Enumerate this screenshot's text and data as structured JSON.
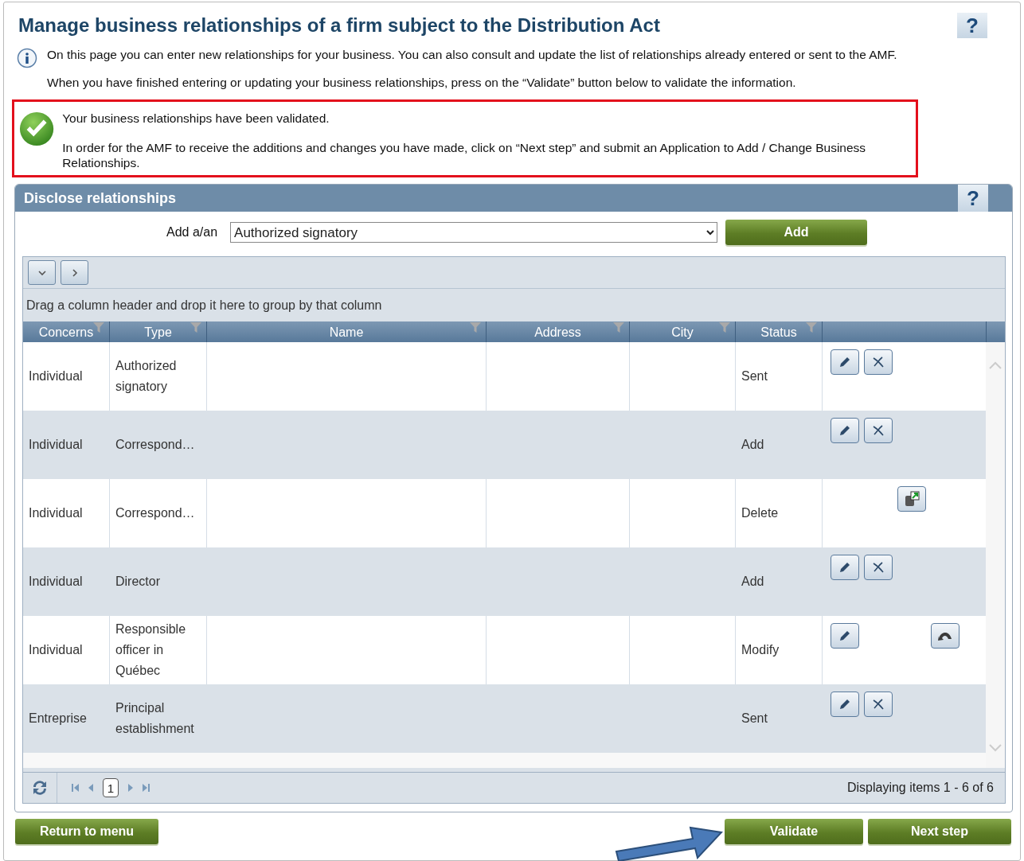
{
  "page": {
    "title": "Manage business relationships of a firm subject to the Distribution Act",
    "help": "?",
    "info": [
      "On this page you can enter new relationships for your business. You can also consult and update the list of relationships already entered or sent to the AMF.",
      "When you have finished entering or updating your business relationships, press on the “Validate” button below to validate the information."
    ]
  },
  "success": {
    "lines": [
      "Your business relationships have been validated.",
      "In order for the AMF to receive the additions and changes you have made, click on “Next step” and submit an Application to Add / Change Business Relationships."
    ]
  },
  "panel": {
    "title": "Disclose relationships",
    "help": "?",
    "add_label": "Add a/an",
    "add_value": "Authorized signatory",
    "add_button": "Add"
  },
  "grid": {
    "group_hint": "Drag a column header and drop it here to group by that column",
    "columns": [
      {
        "label": "Concerns"
      },
      {
        "label": "Type"
      },
      {
        "label": "Name"
      },
      {
        "label": "Address"
      },
      {
        "label": "City"
      },
      {
        "label": "Status"
      }
    ],
    "rows": [
      {
        "concerns": "Individual",
        "type": "Authorized signatory",
        "status": "Sent",
        "actions": [
          {
            "kind": "edit"
          },
          {
            "kind": "delete"
          }
        ]
      },
      {
        "concerns": "Individual",
        "type": "Correspond…",
        "status": "Add",
        "actions": [
          {
            "kind": "edit"
          },
          {
            "kind": "delete"
          }
        ]
      },
      {
        "concerns": "Individual",
        "type": "Correspond…",
        "status": "Delete",
        "actions": [
          {
            "kind": "restore"
          }
        ]
      },
      {
        "concerns": "Individual",
        "type": "Director",
        "status": "Add",
        "actions": [
          {
            "kind": "edit"
          },
          {
            "kind": "delete"
          }
        ]
      },
      {
        "concerns": "Individual",
        "type": "Responsible officer in Québec",
        "status": "Modify",
        "actions": [
          {
            "kind": "edit"
          },
          {
            "kind": "undo"
          }
        ]
      },
      {
        "concerns": "Entreprise",
        "type": "Principal establishment",
        "status": "Sent",
        "actions": [
          {
            "kind": "edit"
          },
          {
            "kind": "delete"
          }
        ]
      }
    ],
    "page_number": "1",
    "summary": "Displaying items 1 - 6 of 6"
  },
  "buttons": [
    {
      "label": "Return to menu",
      "kind": "left"
    },
    {
      "label": "Validate",
      "kind": "right"
    },
    {
      "label": "Next step",
      "kind": "right"
    }
  ]
}
